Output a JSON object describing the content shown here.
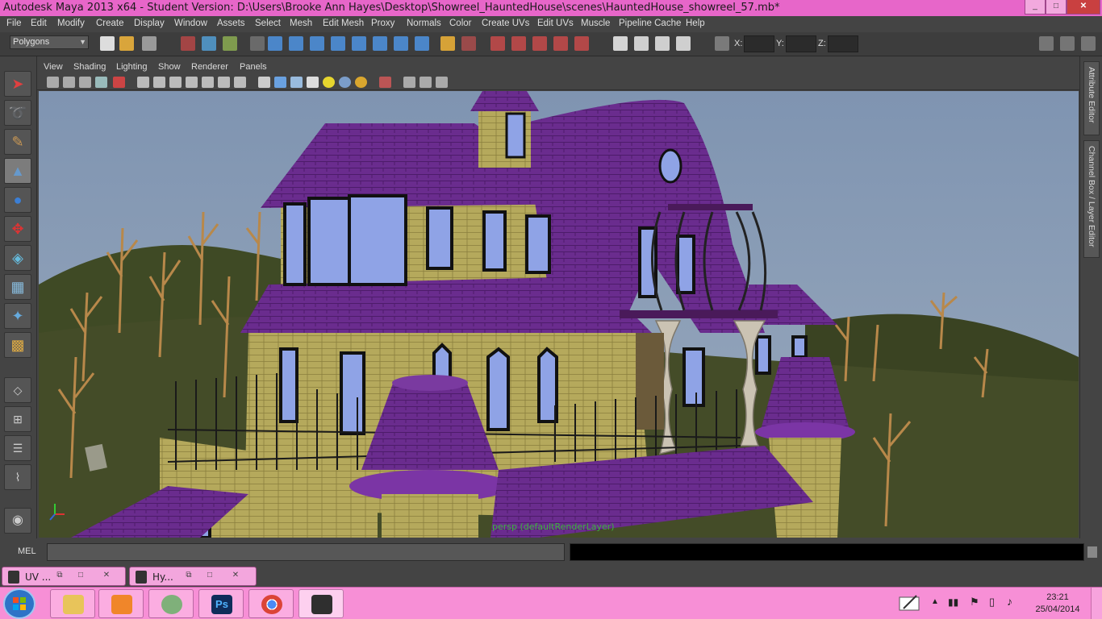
{
  "window": {
    "title": "Autodesk Maya 2013 x64 - Student Version: D:\\Users\\Brooke Ann Hayes\\Desktop\\Showreel_HauntedHouse\\scenes\\HauntedHouse_showreel_57.mb*",
    "minimize": "_",
    "maximize": "□",
    "close": "✕"
  },
  "menubar": {
    "items": [
      "File",
      "Edit",
      "Modify",
      "Create",
      "Display",
      "Window",
      "Assets",
      "Select",
      "Mesh",
      "Edit Mesh",
      "Proxy",
      "Normals",
      "Color",
      "Create UVs",
      "Edit UVs",
      "Muscle",
      "Pipeline Cache",
      "Help"
    ]
  },
  "statusline": {
    "menu_set": "Polygons",
    "x_label": "X:",
    "y_label": "Y:",
    "z_label": "Z:",
    "x_value": "",
    "y_value": "",
    "z_value": ""
  },
  "panel": {
    "menus": [
      "View",
      "Shading",
      "Lighting",
      "Show",
      "Renderer",
      "Panels"
    ],
    "camera_label": "persp (defaultRenderLayer)"
  },
  "right_tabs": [
    "Attribute Editor",
    "Channel Box / Layer Editor"
  ],
  "command_line": {
    "label": "MEL",
    "input": "",
    "output": ""
  },
  "minimized_windows": [
    {
      "label": "UV ..."
    },
    {
      "label": "Hy..."
    }
  ],
  "taskbar": {
    "apps": [
      "explorer-icon",
      "media-player-icon",
      "media-center-icon",
      "photoshop-icon",
      "chrome-icon",
      "maya-icon"
    ],
    "photoshop_text": "Ps",
    "clock_time": "23:21",
    "clock_date": "25/04/2014"
  },
  "colors": {
    "titlebar": "#e766c9",
    "taskbar": "#f78fd6",
    "maya_ui": "#444444",
    "viewport_sky": "#8c9eb6",
    "roof_purple": "#6a2c8e",
    "wall_yellow": "#b5a95c",
    "camera_label": "#3cb33c"
  }
}
